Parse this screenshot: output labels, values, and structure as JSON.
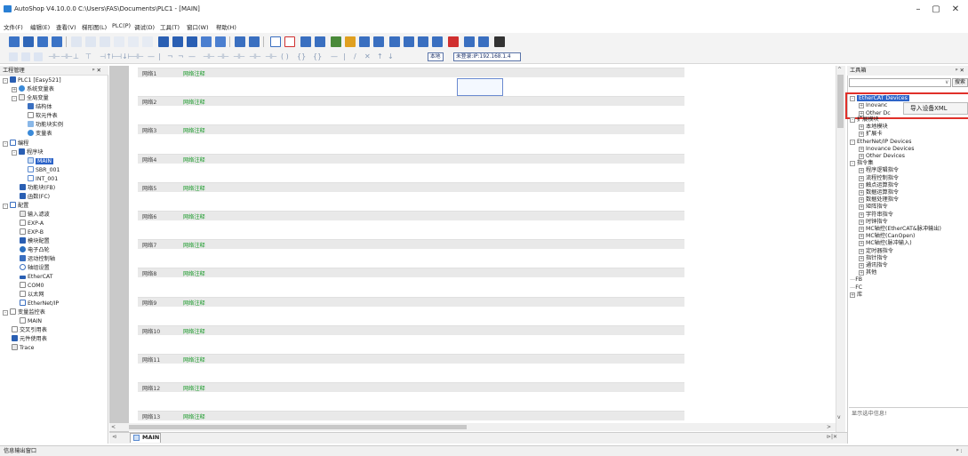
{
  "window": {
    "title": "AutoShop V4.10.0.0  C:\\Users\\FAS\\Documents\\PLC1 - [MAIN]",
    "minimize": "–",
    "maximize": "▢",
    "close": "✕"
  },
  "menu": [
    "文件(F)",
    "编辑(E)",
    "查看(V)",
    "梯形图(L)",
    "PLC(P)",
    "调试(D)",
    "工具(T)",
    "窗口(W)",
    "帮助(H)"
  ],
  "toolbar": {
    "local_label": "本地",
    "login_label": "未登录:IP:192.168.1.4"
  },
  "project_panel": {
    "title": "工程管理",
    "pin": "ᵖ ✕",
    "tree": [
      "PLC1 [Easy521]",
      "系统变量表",
      "全局变量",
      "结构体",
      "软元件表",
      "功能块实例",
      "变量表",
      "编程",
      "程序块",
      "MAIN",
      "SBR_001",
      "INT_001",
      "功能块(FB)",
      "函数(FC)",
      "配置",
      "输入滤波",
      "EXP-A",
      "EXP-B",
      "模块配置",
      "电子凸轮",
      "运动控制轴",
      "轴组设置",
      "EtherCAT",
      "COM0",
      "以太网",
      "EtherNet/IP",
      "变量监控表",
      "MAIN",
      "交叉引用表",
      "元件使用表",
      "Trace"
    ]
  },
  "ladder": {
    "rungs": [
      {
        "num": "网络1",
        "comment": "网络注释"
      },
      {
        "num": "网络2",
        "comment": "网络注释"
      },
      {
        "num": "网络3",
        "comment": "网络注释"
      },
      {
        "num": "网络4",
        "comment": "网络注释"
      },
      {
        "num": "网络5",
        "comment": "网络注释"
      },
      {
        "num": "网络6",
        "comment": "网络注释"
      },
      {
        "num": "网络7",
        "comment": "网络注释"
      },
      {
        "num": "网络8",
        "comment": "网络注释"
      },
      {
        "num": "网络9",
        "comment": "网络注释"
      },
      {
        "num": "网络10",
        "comment": "网络注释"
      },
      {
        "num": "网络11",
        "comment": "网络注释"
      },
      {
        "num": "网络12",
        "comment": "网络注释"
      },
      {
        "num": "网络13",
        "comment": "网络注释"
      }
    ],
    "tab": "MAIN"
  },
  "toolbox": {
    "title": "工具箱",
    "pin": "ᵖ ✕",
    "search_btn": "搜索",
    "tree": [
      "EtherCAT Devices",
      "Inovanc",
      "Other Dc",
      "扩展模块",
      "本地模块",
      "扩展卡",
      "EtherNet/IP Devices",
      "Inovance Devices",
      "Other Devices",
      "指令集",
      "程序逻辑指令",
      "流程控制指令",
      "触点运算指令",
      "数据运算指令",
      "数据处理指令",
      "矩阵指令",
      "字符串指令",
      "时钟指令",
      "MC轴控(EtherCAT&脉冲输出)",
      "MC轴控(CanOpen)",
      "MC轴控(脉冲输入)",
      "定时器指令",
      "指针指令",
      "通讯指令",
      "其他",
      "FB",
      "FC",
      "库"
    ],
    "context_menu": "导入设备XML",
    "info": "显示选中信息!"
  },
  "status": {
    "output": "信息输出窗口"
  }
}
